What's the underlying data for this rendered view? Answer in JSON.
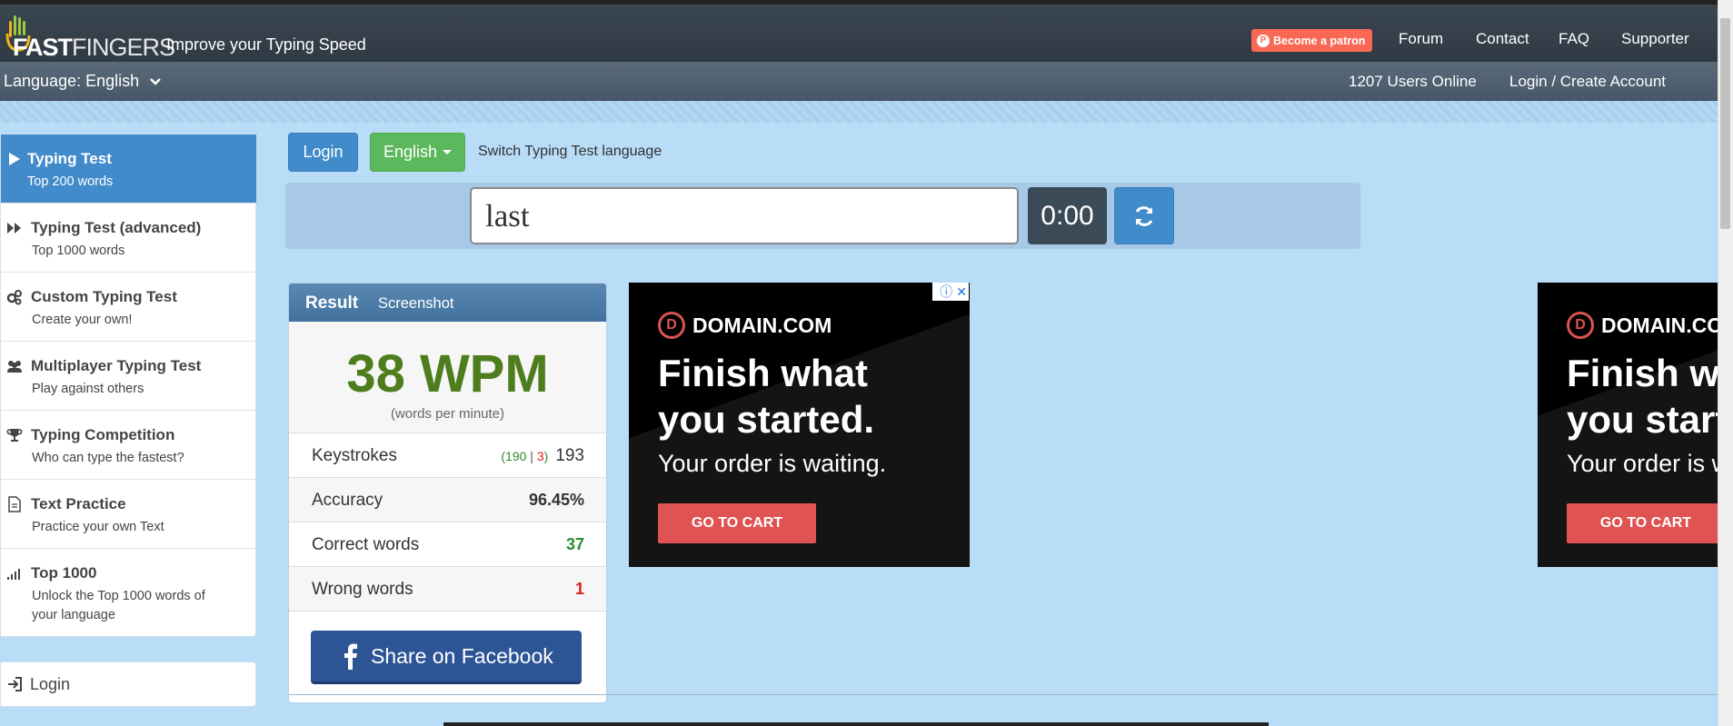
{
  "header": {
    "logo_text_bold": "FAST",
    "logo_text_light": "FINGERS",
    "tagline": "Improve your Typing Speed",
    "patron_label": "Become a patron",
    "nav": [
      "Forum",
      "Contact",
      "FAQ",
      "Supporter"
    ]
  },
  "subbar": {
    "language": "Language: English",
    "users_online": "1207 Users Online",
    "login_create": "Login / Create Account"
  },
  "sidebar": {
    "items": [
      {
        "title": "Typing Test",
        "sub": "Top 200 words",
        "icon": "play-icon",
        "active": true
      },
      {
        "title": "Typing Test (advanced)",
        "sub": "Top 1000 words",
        "icon": "fast-forward-icon"
      },
      {
        "title": "Custom Typing Test",
        "sub": "Create your own!",
        "icon": "gears-icon"
      },
      {
        "title": "Multiplayer Typing Test",
        "sub": "Play against others",
        "icon": "users-icon"
      },
      {
        "title": "Typing Competition",
        "sub": "Who can type the fastest?",
        "icon": "trophy-icon"
      },
      {
        "title": "Text Practice",
        "sub": "Practice your own Text",
        "icon": "file-icon"
      },
      {
        "title": "Top 1000",
        "sub": "Unlock the Top 1000 words of your language",
        "icon": "signal-icon"
      }
    ],
    "login": "Login"
  },
  "controls": {
    "login": "Login",
    "language": "English",
    "switch_label": "Switch Typing Test language",
    "input_value": "last",
    "timer": "0:00"
  },
  "result": {
    "title": "Result",
    "screenshot": "Screenshot",
    "wpm": "38 WPM",
    "wpm_sub": "(words per minute)",
    "keystrokes_label": "Keystrokes",
    "keystrokes_open": "(",
    "keystrokes_correct": "190",
    "keystrokes_sep": " | ",
    "keystrokes_wrong": "3",
    "keystrokes_close": ")",
    "keystrokes_total": "193",
    "accuracy_label": "Accuracy",
    "accuracy": "96.45%",
    "correct_label": "Correct words",
    "correct": "37",
    "wrong_label": "Wrong words",
    "wrong": "1",
    "facebook": "Share on Facebook"
  },
  "ad": {
    "brand": "DOMAIN.COM",
    "line1": "Finish what",
    "line2": "you started.",
    "sub": "Your order is waiting.",
    "cta": "GO TO CART"
  },
  "colors": {
    "accent": "#428bca",
    "success": "#5cb85c",
    "wpm": "#4e7d1e",
    "correct": "#2e8b2e",
    "wrong": "#d9231e",
    "patron": "#f96854"
  }
}
